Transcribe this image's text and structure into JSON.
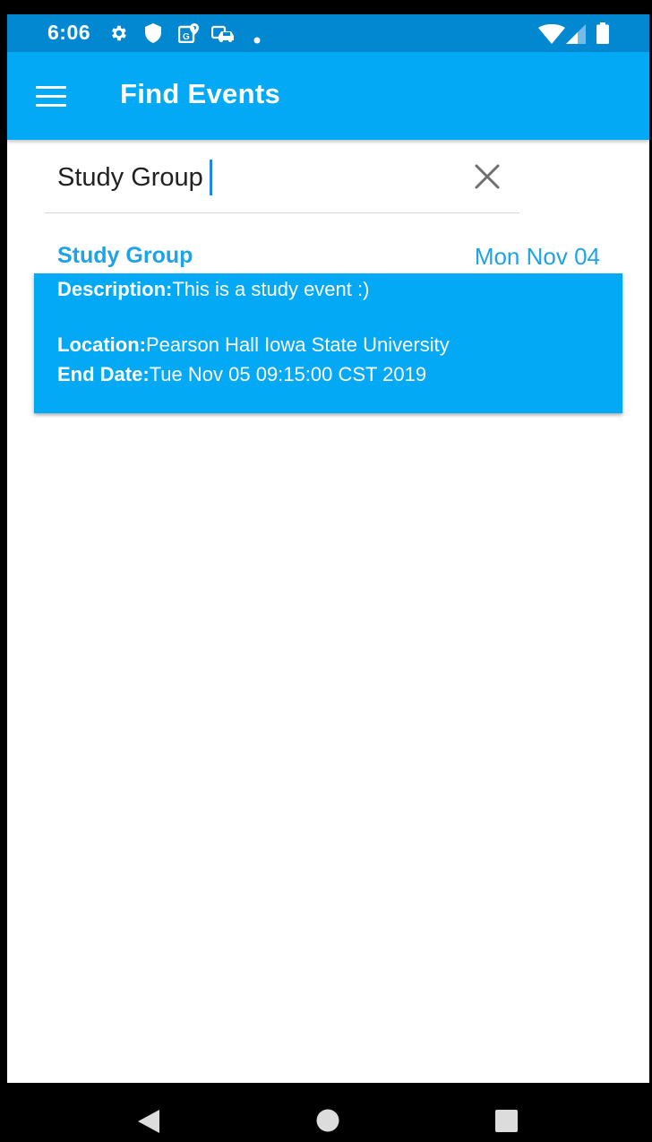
{
  "status_bar": {
    "time": "6:06",
    "icons": [
      "gear-icon",
      "shield-icon",
      "map-pin-icon",
      "car-icon",
      "dot-icon",
      "wifi-icon",
      "signal-icon",
      "battery-icon"
    ]
  },
  "app_bar": {
    "title": "Find Events",
    "menu_icon": "hamburger-menu-icon"
  },
  "search": {
    "value": "Study Group",
    "clear_icon": "close-icon"
  },
  "results": [
    {
      "title": "Study Group",
      "date": "Mon Nov 04",
      "description_label": "Description:",
      "description": "This is a study event :)",
      "location_label": "Location:",
      "location": "Pearson Hall Iowa State University",
      "end_date_label": "End Date:",
      "end_date": "Tue Nov 05 09:15:00 CST 2019"
    }
  ],
  "nav_bar": {
    "icons": [
      "back-icon",
      "home-icon",
      "recents-icon"
    ]
  },
  "colors": {
    "status_bar": "#0288d1",
    "app_bar": "#03a9f4",
    "accent_text": "#1ea3e7",
    "card": "#03a9f4"
  }
}
